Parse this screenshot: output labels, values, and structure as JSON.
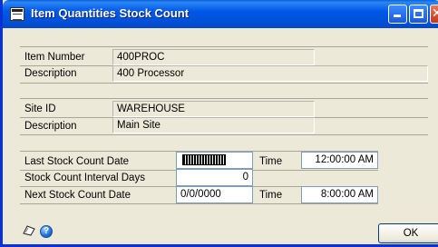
{
  "window": {
    "title": "Item Quantities Stock Count"
  },
  "item": {
    "number_label": "Item Number",
    "number_value": "400PROC",
    "description_label": "Description",
    "description_value": "400 Processor"
  },
  "site": {
    "id_label": "Site ID",
    "id_value": "WAREHOUSE",
    "description_label": "Description",
    "description_value": "Main Site"
  },
  "counts": {
    "last_label": "Last Stock Count Date",
    "last_time_label": "Time",
    "last_time_value": "12:00:00 AM",
    "interval_label": "Stock Count Interval Days",
    "interval_value": "0",
    "next_label": "Next Stock Count Date",
    "next_date_value": "0/0/0000",
    "next_time_label": "Time",
    "next_time_value": "8:00:00 AM"
  },
  "footer": {
    "ok_label": "OK"
  },
  "icons": {
    "window": "window-form-icon",
    "note": "note-icon",
    "help": "help-icon"
  }
}
